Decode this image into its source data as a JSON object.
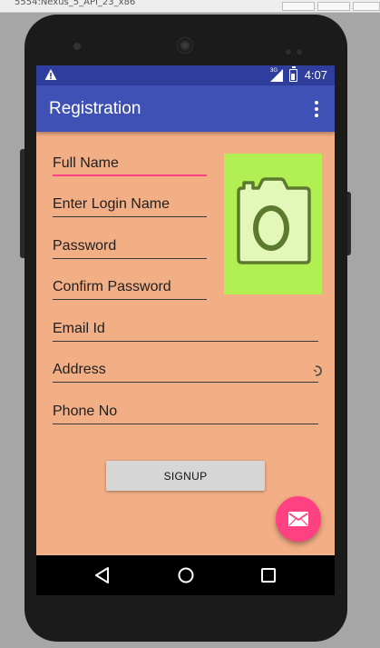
{
  "host_window": {
    "title": "5554:Nexus_5_API_23_x86"
  },
  "status_bar": {
    "warning_icon": "warning-triangle-icon",
    "network_label": "3G",
    "time": "4:07"
  },
  "app_bar": {
    "title": "Registration",
    "overflow_icon": "more-vert-icon"
  },
  "form": {
    "full_name": {
      "placeholder": "Full Name",
      "focused": true
    },
    "login_name": {
      "placeholder": "Enter Login Name"
    },
    "password": {
      "placeholder": "Password"
    },
    "confirm_password": {
      "placeholder": "Confirm Password"
    },
    "email": {
      "placeholder": "Email Id"
    },
    "address": {
      "placeholder": "Address"
    },
    "phone": {
      "placeholder": "Phone No"
    },
    "photo_icon": "camera-icon"
  },
  "signup_button": {
    "label": "SIGNUP"
  },
  "fab": {
    "icon": "email-icon"
  },
  "colors": {
    "status_bar": "#2f3d9c",
    "app_bar": "#3f51b5",
    "screen_background": "#f2ae85",
    "accent": "#ff4081",
    "photo_background": "#b2ef52"
  }
}
